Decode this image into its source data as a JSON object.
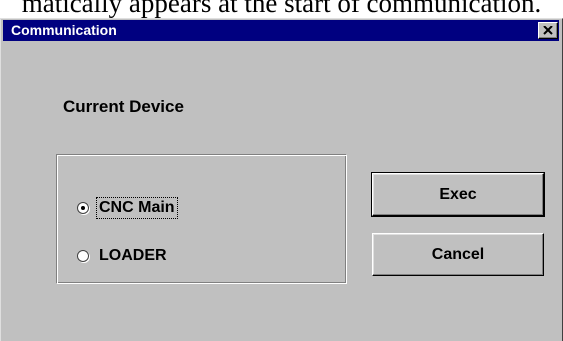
{
  "document": {
    "text": "matically appears at the start of communication."
  },
  "window": {
    "title": "Communication",
    "close_icon": "close-x-icon"
  },
  "form": {
    "current_device_label": "Current Device",
    "options": [
      {
        "label": "CNC Main",
        "selected": true
      },
      {
        "label": "LOADER",
        "selected": false
      }
    ]
  },
  "buttons": {
    "exec_label": "Exec",
    "cancel_label": "Cancel"
  },
  "colors": {
    "titlebar": "#000080",
    "face": "#c0c0c0"
  }
}
